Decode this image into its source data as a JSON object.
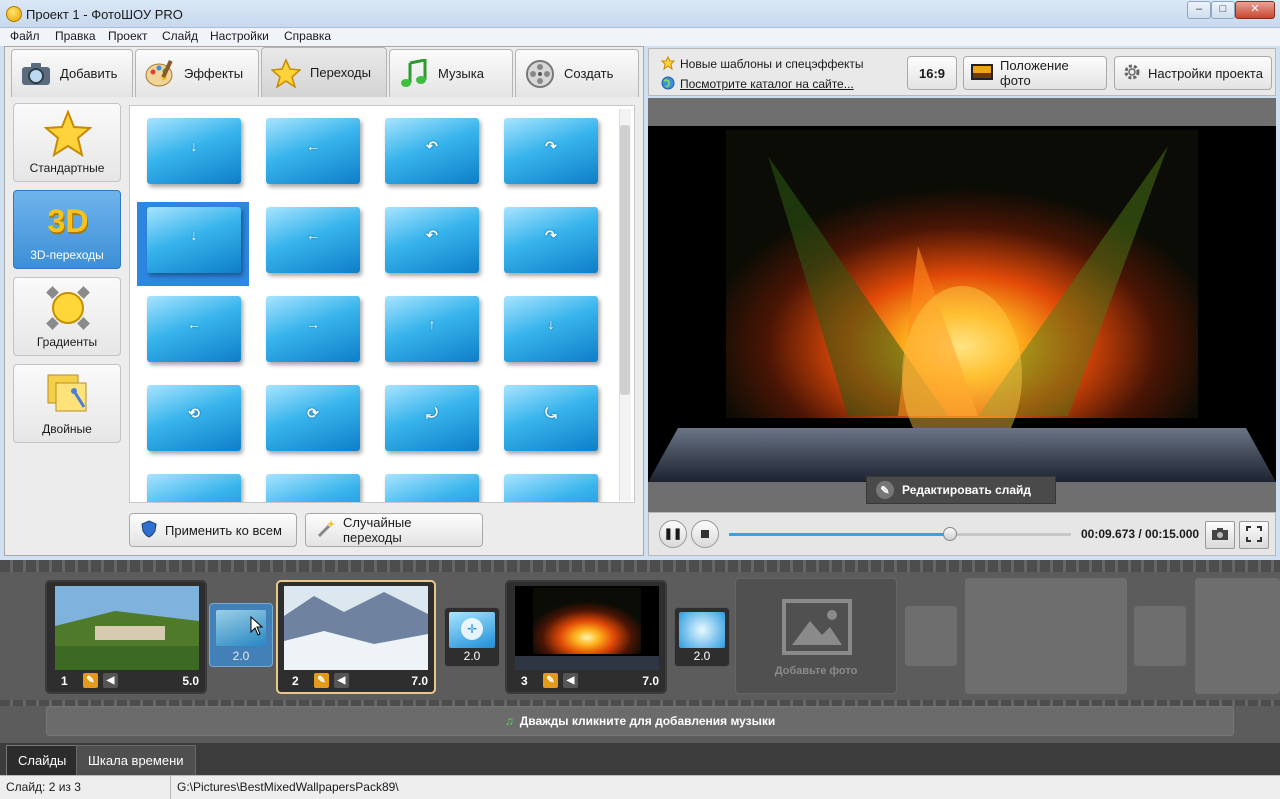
{
  "window": {
    "title": "Проект 1 - ФотоШОУ PRO",
    "minimize": "–",
    "maximize": "□",
    "close": "✕"
  },
  "menu": [
    "Файл",
    "Правка",
    "Проект",
    "Слайд",
    "Настройки",
    "Справка"
  ],
  "tabs": [
    {
      "label": "Добавить",
      "icon": "camera-icon"
    },
    {
      "label": "Эффекты",
      "icon": "palette-icon"
    },
    {
      "label": "Переходы",
      "icon": "star-icon",
      "active": true
    },
    {
      "label": "Музыка",
      "icon": "music-note-icon"
    },
    {
      "label": "Создать",
      "icon": "film-reel-icon"
    }
  ],
  "categories": [
    {
      "label": "Стандартные",
      "icon": "star-icon"
    },
    {
      "label": "3D-переходы",
      "icon_text": "3D",
      "active": true
    },
    {
      "label": "Градиенты",
      "icon": "gradient-icon"
    },
    {
      "label": "Двойные",
      "icon": "double-notes-icon"
    }
  ],
  "buttons": {
    "apply_all": "Применить ко всем",
    "random_transitions": "Случайные переходы"
  },
  "promo": {
    "line1": "Новые шаблоны и спецэффекты",
    "line2": "Посмотрите каталог на сайте..."
  },
  "toolbar": {
    "ratio": "16:9",
    "photo_position": "Положение фото",
    "project_settings": "Настройки проекта"
  },
  "preview": {
    "edit_slide": "Редактировать слайд"
  },
  "player": {
    "time": "00:09.673 / 00:15.000",
    "progress": 0.645
  },
  "slides": [
    {
      "number": "1",
      "duration": "5.0"
    },
    {
      "number": "2",
      "duration": "7.0",
      "selected": true
    },
    {
      "number": "3",
      "duration": "7.0"
    }
  ],
  "transitions": [
    "2.0",
    "2.0",
    "2.0"
  ],
  "add_photo": "Добавьте фото",
  "music_hint": "Дважды кликните для добавления музыки",
  "bottom_tabs": [
    "Слайды",
    "Шкала времени"
  ],
  "status": {
    "slide": "Слайд: 2 из 3",
    "path": "G:\\Pictures\\BestMixedWallpapersPack89\\"
  },
  "colors": {
    "accent": "#2d86e0",
    "selected_border": "#e9c98a",
    "progress": "#2ba7e6"
  }
}
